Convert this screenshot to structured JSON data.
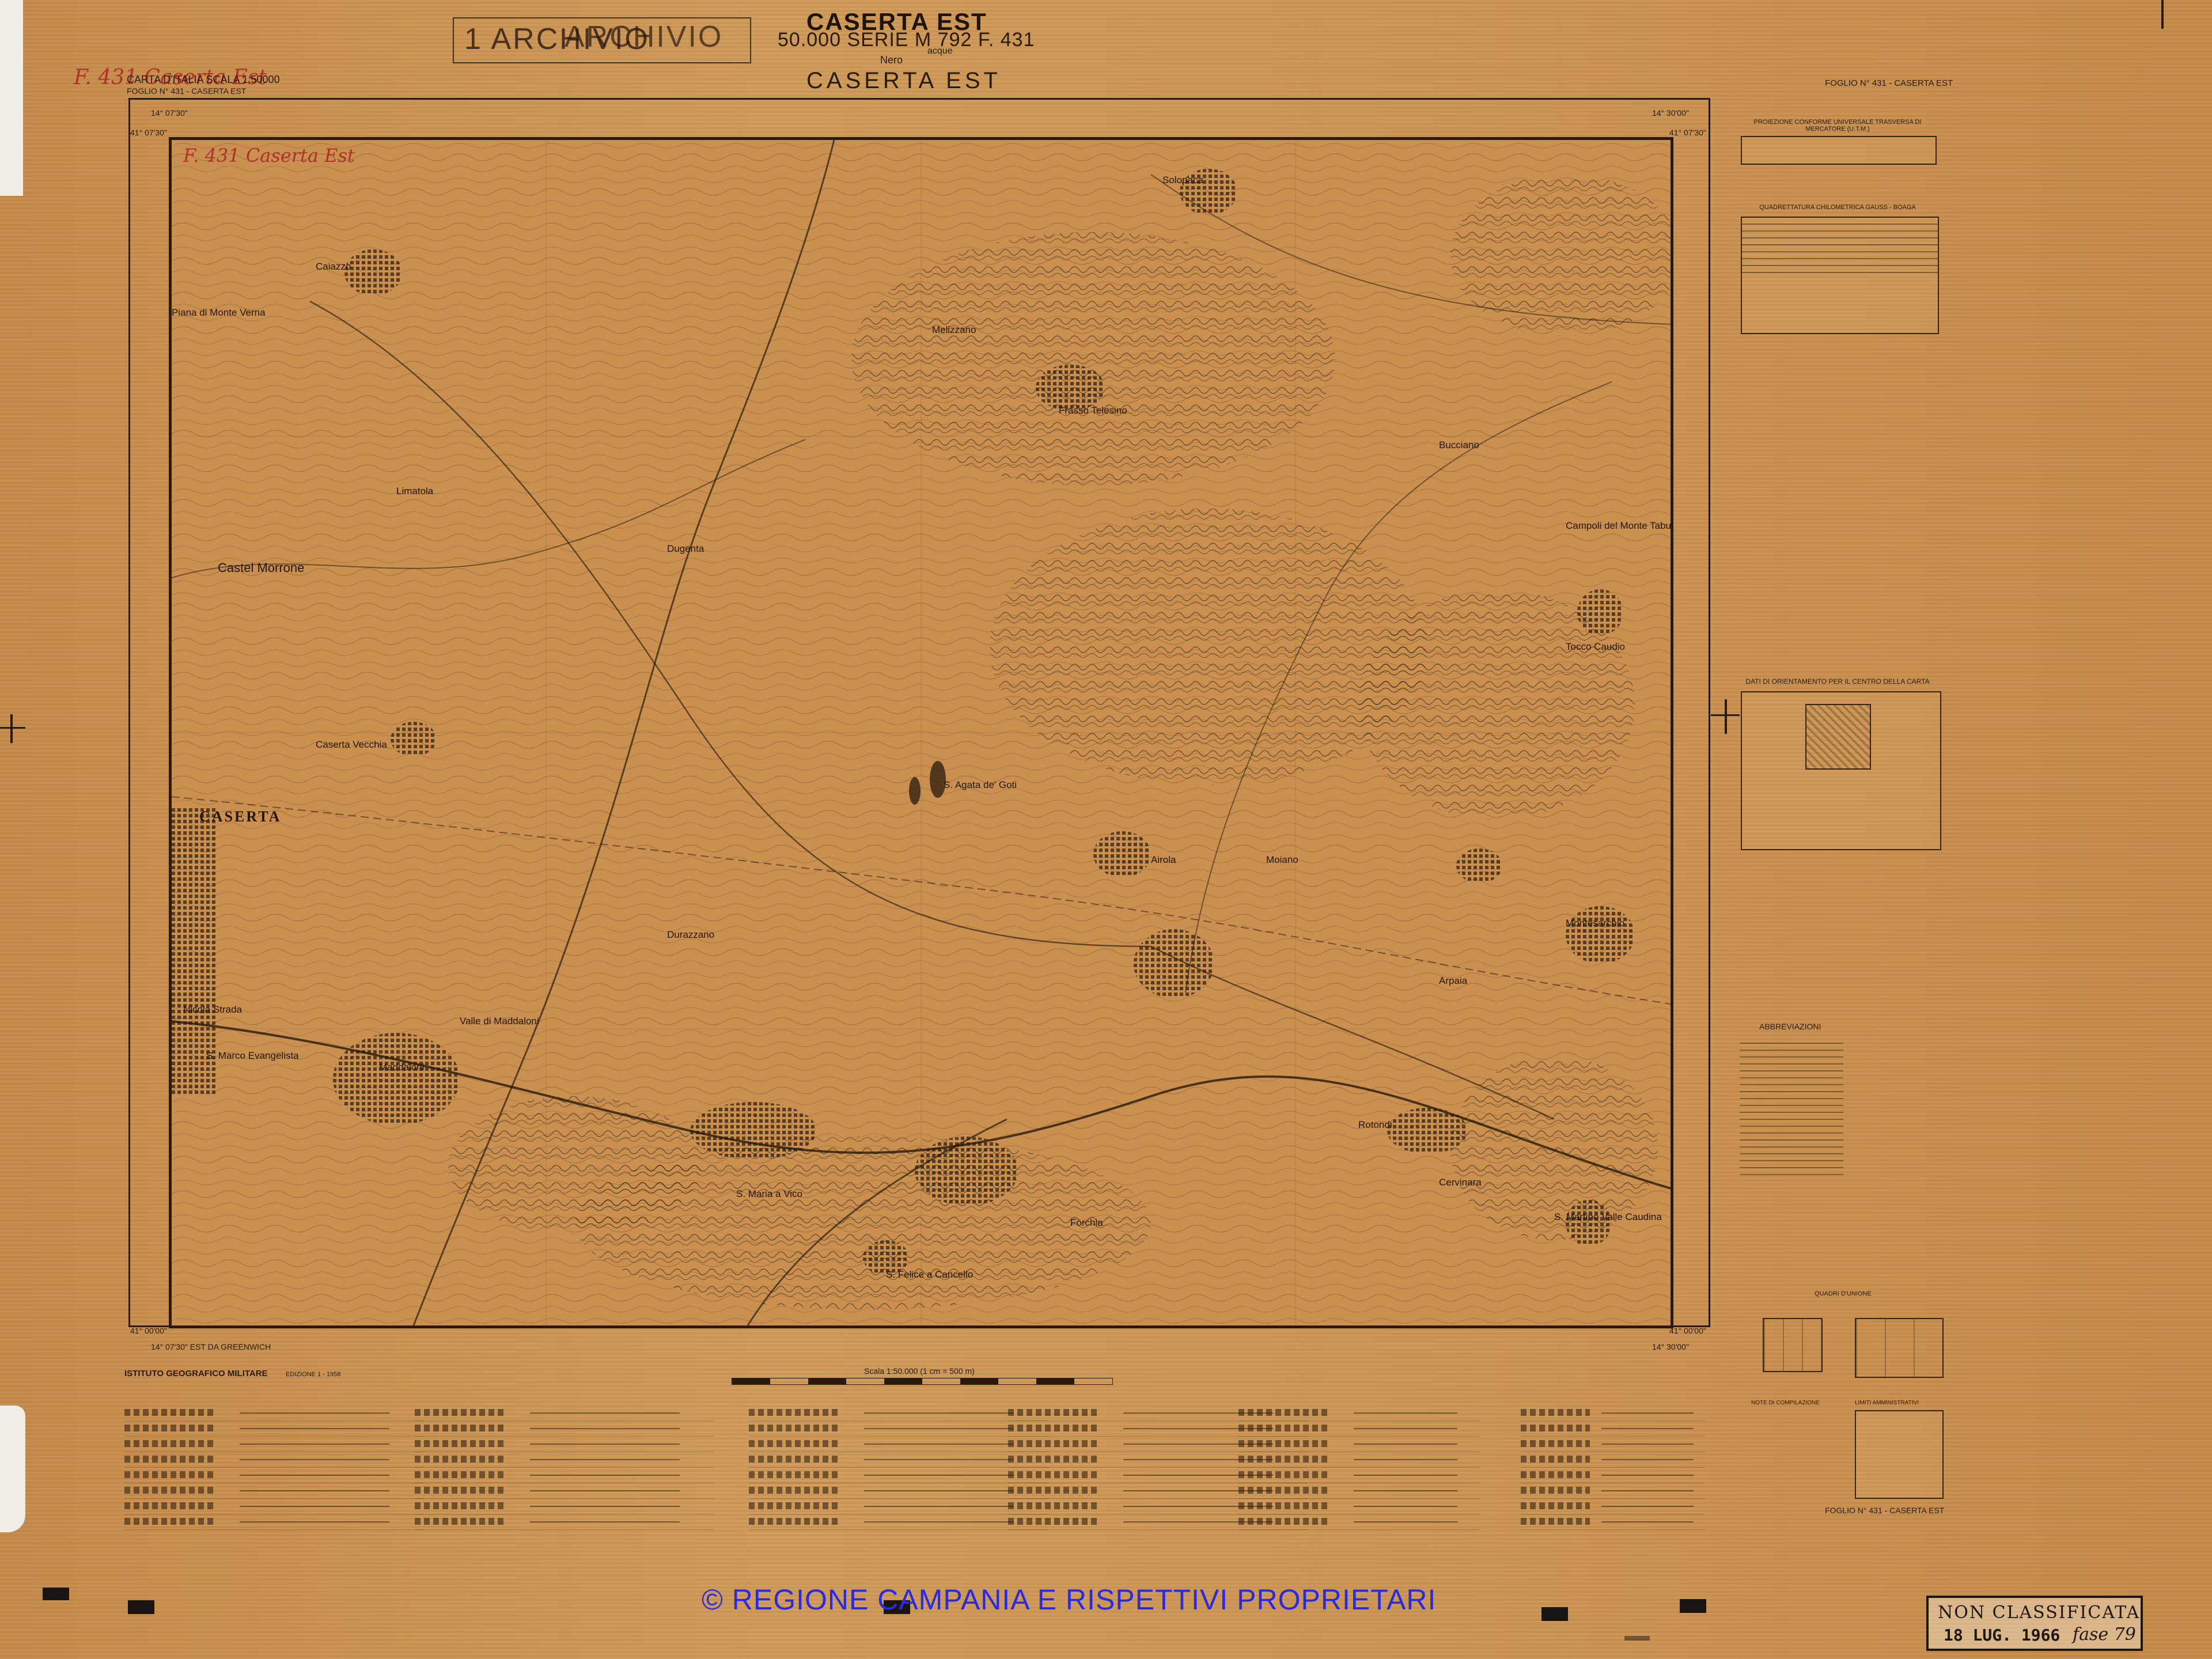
{
  "header": {
    "archivio_stamp": "1 ARCHIVIO",
    "archivio_stamp_overprint": "ARCHIVIO",
    "title_top": "CASERTA EST",
    "series_line": "50.000  SERIE M 792  F. 431",
    "nero_label": "Nero",
    "acque_label": "acque",
    "map_title": "CASERTA EST",
    "handwritten_top_left": "F. 431 Caserta Est",
    "carta_scale": "CARTA D'ITALIA SCALA 1:50000",
    "foglio_left": "FOGLIO N° 431 - CASERTA EST",
    "foglio_right": "FOGLIO N° 431 - CASERTA EST",
    "handwritten_inframe": "F. 431 Caserta Est"
  },
  "coordinates": {
    "top_left_lon": "14° 07'30\"",
    "top_left_lat": "41° 07'30\"",
    "top_right_lon": "14° 30'00\"",
    "top_right_lat": "41° 07'30\"",
    "bottom_left_lat": "41° 00'00\"",
    "bottom_left_lon": "14° 07'30\" EST DA GREENWICH",
    "bottom_right_lat": "41° 00'00\"",
    "bottom_right_lon": "14° 30'00\""
  },
  "places": [
    {
      "name": "Solopaca"
    },
    {
      "name": "Caiazzo"
    },
    {
      "name": "Piana di Monte Verna"
    },
    {
      "name": "Frasso Telesino"
    },
    {
      "name": "Melizzano"
    },
    {
      "name": "Dugenta"
    },
    {
      "name": "Castel Morrone"
    },
    {
      "name": "Limatola"
    },
    {
      "name": "S. Agata de' Goti"
    },
    {
      "name": "Campoli del Monte Taburno"
    },
    {
      "name": "Tocco Caudio"
    },
    {
      "name": "Airola"
    },
    {
      "name": "Moiano"
    },
    {
      "name": "Montesarchio"
    },
    {
      "name": "Arpaia"
    },
    {
      "name": "Rotondi"
    },
    {
      "name": "Cervinara"
    },
    {
      "name": "S. Martino Valle Caudina"
    },
    {
      "name": "Maddaloni"
    },
    {
      "name": "S. Marco Evangelista"
    },
    {
      "name": "Nicola Strada"
    },
    {
      "name": "S. Maria a Vico"
    },
    {
      "name": "S. Felice a Cancello"
    },
    {
      "name": "Durazzano"
    },
    {
      "name": "Forchia"
    },
    {
      "name": "Valle di Maddaloni"
    },
    {
      "name": "Caserta Vecchia"
    },
    {
      "name": "Bucciano"
    }
  ],
  "big_place": "CASERTA",
  "right_panels": {
    "projection_title": "PROIEZIONE CONFORME UNIVERSALE TRASVERSA DI MERCATORE (U.T.M.)",
    "quadrettatura_title": "QUADRETTATURA CHILOMETRICA GAUSS - BOAGA",
    "orientamento_title": "DATI DI ORIENTAMENTO PER IL CENTRO DELLA CARTA",
    "abbreviazioni_title": "ABBREVIAZIONI",
    "quadri_title": "QUADRI D'UNIONE",
    "notizie_title": "NOTE DI COMPILAZIONE",
    "limiti_title": "LIMITI AMMINISTRATIVI"
  },
  "bottom": {
    "istituto": "ISTITUTO GEOGRAFICO MILITARE",
    "edizione": "EDIZIONE 1 - 1958",
    "scala_label": "Scala 1:50.000 (1 cm = 500 m)",
    "copyright": "© REGIONE CAMPANIA E RISPETTIVI PROPRIETARI"
  },
  "stamp": {
    "line1": "NON CLASSIFICATA",
    "date": "18 LUG. 1966",
    "note": "fase 79"
  },
  "colors": {
    "paper": "#c8924f",
    "ink": "#2b1a0b",
    "handwriting": "#b0302a",
    "copyright": "#2a2ae0"
  }
}
